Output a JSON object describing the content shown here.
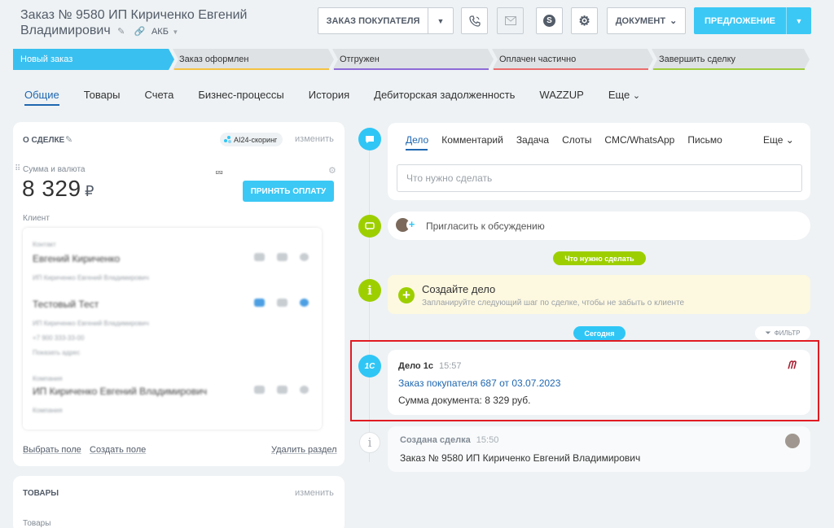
{
  "header": {
    "title_line1": "Заказ № 9580 ИП Кириченко Евгений",
    "title_line2": "Владимирович",
    "tag": "АКБ",
    "order_button": "ЗАКАЗ ПОКУПАТЕЛЯ",
    "document_button": "ДОКУМЕНТ",
    "offer_button": "ПРЕДЛОЖЕНИЕ"
  },
  "stages": [
    {
      "label": "Новый заказ",
      "color": "#39c0f0",
      "active": true
    },
    {
      "label": "Заказ оформлен",
      "color": "#f4c242"
    },
    {
      "label": "Отгружен",
      "color": "#8e6bd6"
    },
    {
      "label": "Оплачен частично",
      "color": "#ea6c6c"
    },
    {
      "label": "Завершить сделку",
      "color": "#9fcc3b"
    }
  ],
  "tabs": [
    "Общие",
    "Товары",
    "Счета",
    "Бизнес-процессы",
    "История",
    "Дебиторская задолженность",
    "WAZZUP",
    "Еще"
  ],
  "about": {
    "title": "О СДЕЛКЕ",
    "ai_badge": "AI24-скоринг",
    "edit": "изменить",
    "sum_label": "Сумма и валюта",
    "sum_value": "8 329",
    "currency": "₽",
    "pay_button": "ПРИНЯТЬ ОПЛАТУ",
    "client_label": "Клиент",
    "contacts": [
      {
        "role": "Контакт",
        "name": "Евгений Кириченко",
        "sub": "ИП Кириченко Евгений Владимирович"
      },
      {
        "role": "",
        "name": "Тестовый Тест",
        "sub": "ИП Кириченко Евгений Владимирович",
        "phone": "+7 900 333-33-00",
        "extra": "Показать адрес"
      },
      {
        "role": "Компания",
        "name": "ИП Кириченко Евгений Владимирович",
        "sub": "Компания"
      }
    ],
    "select_field": "Выбрать поле",
    "create_field": "Создать поле",
    "delete_section": "Удалить раздел"
  },
  "products": {
    "title": "ТОВАРЫ",
    "edit": "изменить",
    "label": "Товары"
  },
  "editor": {
    "tabs": [
      "Дело",
      "Комментарий",
      "Задача",
      "Слоты",
      "СМС/WhatsApp",
      "Письмо"
    ],
    "more": "Еще",
    "placeholder": "Что нужно сделать"
  },
  "invite_text": "Пригласить к обсуждению",
  "todo_pill": "Что нужно сделать",
  "create_task": {
    "title": "Создайте дело",
    "subtitle": "Запланируйте следующий шаг по сделке, чтобы не забыть о клиенте"
  },
  "today_pill": "Сегодня",
  "filter": "ФИЛЬТР",
  "activity_1c": {
    "icon_text": "1С",
    "title": "Дело 1с",
    "time": "15:57",
    "link": "Заказ покупателя 687 от 03.07.2023",
    "body": "Сумма документа: 8 329 руб."
  },
  "created_deal": {
    "title": "Создана сделка",
    "time": "15:50",
    "body": "Заказ № 9580 ИП Кириченко Евгений Владимирович"
  },
  "colors": {
    "accent": "#3bc8f5",
    "link": "#2067b0",
    "timeline_green": "#9dcf00",
    "highlight": "#e11b22"
  }
}
